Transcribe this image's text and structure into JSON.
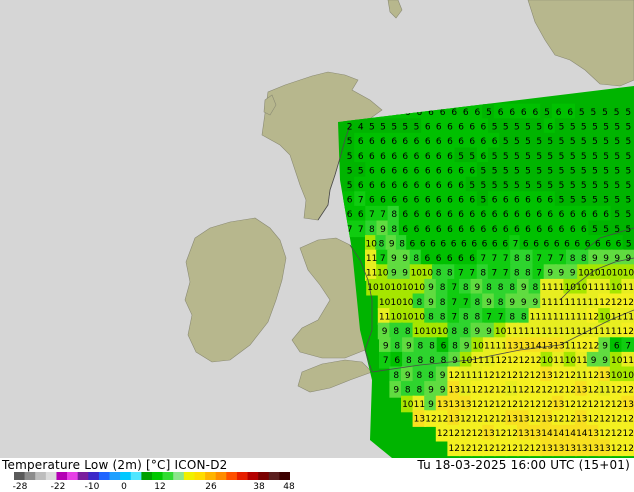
{
  "map": {
    "title": "Temperature Low (2m) [°C] ICON-D2",
    "valid_time": "Tu 18-03-2025 16:00 UTC (15+01)",
    "colors": {
      "sea": "#d6d6d6",
      "land": "#b7b78d",
      "coast": "#8a8a73"
    },
    "legend": {
      "tick_labels": [
        "-28",
        "-22",
        "-10",
        "0",
        "12",
        "26",
        "38",
        "48"
      ],
      "colors": [
        "#5a5a5a",
        "#8c8c8c",
        "#bdbdbd",
        "#dcdcdc",
        "#b400b4",
        "#e640e6",
        "#7a1e9e",
        "#3c28c8",
        "#1e64ff",
        "#1ea0ff",
        "#00c8ff",
        "#50e6ff",
        "#00a000",
        "#00c800",
        "#32dc32",
        "#8ce68c",
        "#f0f000",
        "#ffdc00",
        "#ffb400",
        "#ff8c00",
        "#ff5000",
        "#e61e00",
        "#b40000",
        "#7a0000",
        "#5a1e1e",
        "#3c0000"
      ]
    },
    "grid_values": {
      "rows": [
        "6 6 6 6 6 6 6 6 6 6 5 6 6 6 6 5 6 6 5 5 5 5 5",
        "2 4 5 5 5 5 5 6 6 6 6 6 6 5 5 5 5 5 6 5 5 5 5 5 5 5",
        "5 6 6 6 6 6 6 6 6 6 6 6 6 6 5 5 5 5 5 5 5 5 5 5 5 5",
        "5 6 6 6 6 6 6 6 6 6 5 5 6 5 5 5 5 5 5 5 5 5 5 5 5 5",
        "5 5 6 6 6 6 6 6 6 6 6 6 5 5 5 5 5 5 5 5 5 5 5 5 5 5",
        "5 6 6 6 6 6 6 6 6 6 6 5 5 5 5 5 5 5 5 5 5 5 5 5 5 5",
        "6 7 6 6 6 6 6 6 6 6 6 6 5 6 6 6 6 6 6 5 5 5 5 5 5 5",
        "6 6 7 7 8 6 6 6 6 6 6 6 6 6 6 6 6 6 6 6 6 6 6 6 5 5",
        "7 7 8 9 8 6 6 6 6 6 6 6 6 6 6 6 6 6 6 6 6 6 5 5 5 5",
        "10 8 9 8 6 6 6 6 6 6 6 6 6 6 7 6 6 6 6 6 6 6 6 6 6 5",
        "11 7 9 9 8 6 6 6 6 6 7 7 7 8 8 7 7 7 8 8 9 9 9 9",
        "11 10 9 9 10 10 8 8 7 7 8 7 7 8 8 7 9 9 9 10 10 10 10 10",
        "10 10 10 10 10 9 8 7 8 9 8 8 8 9 8 11 11 10 10 11 11 10 11",
        "10 10 10 8 9 8 7 7 8 9 8 9 9 9 11 11 11 11 11 12 12 12",
        "11 10 10 10 8 8 7 8 8 7 7 8 8 11 11 11 11 11 12 10 11 11",
        "9 8 8 10 10 10 8 8 9 9 10 11 11 11 11 11 11 11 11 11 11 12",
        "9 8 9 8 8 6 8 9 10 11 11 13 13 14 13 13 11 12 12 9 6 7",
        "7 6 8 8 8 8 9 10 11 11 12 12 12 12 10 11 10 11 9 9 10 11",
        "8 9 8 8 9 12 11 11 12 12 12 12 12 13 12 12 11 12 13 10 10",
        "9 8 8 9 9 13 11 12 12 12 11 12 12 12 12 12 13 12 11 12 12",
        "10 11 9 13 13 13 12 12 12 12 12 12 12 13 12 12 12 12 12 13",
        "13 12 12 13 12 12 12 12 13 13 12 13 12 12 13 12 12 12 12",
        "12 12 12 12 13 12 12 13 13 14 14 14 14 13 12 12 12",
        "12 12 12 12 12 12 12 12 13 13 13 13 13 13 12 12"
      ]
    }
  }
}
